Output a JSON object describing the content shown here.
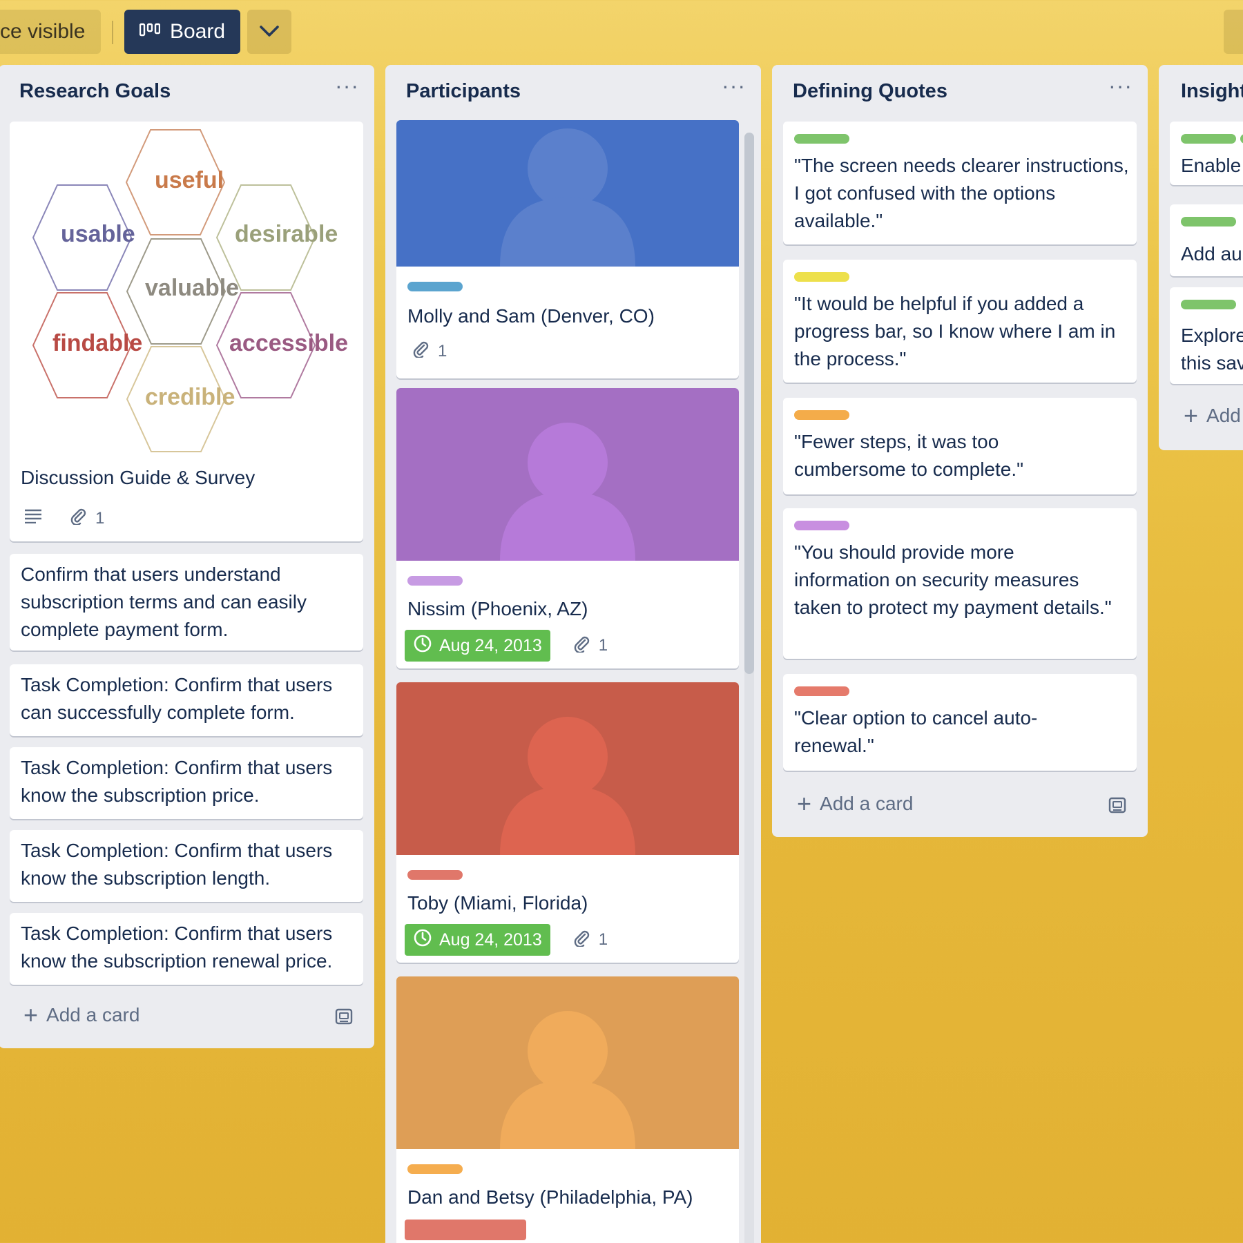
{
  "topbar": {
    "visibility_label": "ce visible",
    "board_label": "Board"
  },
  "colors": {
    "green": "#61bd4f",
    "blue_label": "#5ba4cf",
    "purple_label": "#c377e0",
    "red_label": "#eb5a46",
    "orange_label": "#ffab4a",
    "yellow_label": "#f2d600",
    "green_label": "#61bd4f"
  },
  "lists": {
    "research": {
      "title": "Research Goals",
      "menu": "···",
      "hex_words": [
        "useful",
        "usable",
        "desirable",
        "valuable",
        "findable",
        "accessible",
        "credible"
      ],
      "cards": [
        {
          "title": "Discussion Guide & Survey",
          "attachments": "1"
        },
        {
          "title": "Confirm that users understand subscription terms and can easily complete payment form."
        },
        {
          "title": "Task Completion: Confirm that users can successfully complete form."
        },
        {
          "title": "Task Completion: Confirm that users know the subscription price."
        },
        {
          "title": "Task Completion: Confirm that users know the subscription length."
        },
        {
          "title": "Task Completion: Confirm that users know the subscription renewal price."
        }
      ],
      "add_card": "Add a card"
    },
    "participants": {
      "title": "Participants",
      "menu": "···",
      "cards": [
        {
          "title": "Molly and Sam (Denver, CO)",
          "attachments": "1",
          "cover": "#4671c6",
          "avatar": "#5b80cc",
          "label": "#5ba4cf"
        },
        {
          "title": "Nissim (Phoenix, AZ)",
          "date": "Aug 24, 2013",
          "attachments": "1",
          "cover": "#a46fc3",
          "avatar": "#b67ad9",
          "label": "#c79be3"
        },
        {
          "title": "Toby (Miami, Florida)",
          "date": "Aug 24, 2013",
          "attachments": "1",
          "cover": "#c75c4a",
          "avatar": "#dd6450",
          "label": "#e0776a"
        },
        {
          "title": "Dan and Betsy (Philadelphia, PA)",
          "cover": "#de9e56",
          "avatar": "#f0ab5b",
          "label": "#f5ad4f"
        }
      ],
      "add_card": "Add a card"
    },
    "quotes": {
      "title": "Defining Quotes",
      "menu": "···",
      "cards": [
        {
          "title": "\"The screen needs clearer instructions, I got confused with the options available.\"",
          "label": "#7ec46b"
        },
        {
          "title": "\"It would be helpful if you added a progress bar, so I know where I am in the process.\"",
          "label": "#ede04b"
        },
        {
          "title": "\"Fewer steps, it was too cumbersome to complete.\"",
          "label": "#f4ac4a"
        },
        {
          "title": "\"You should provide more information on security measures taken to protect my payment details.\"",
          "label": "#c88fe0"
        },
        {
          "title": "\"Clear option to cancel auto-renewal.\"",
          "label": "#e57a6b"
        }
      ],
      "add_card": "Add a card"
    },
    "insights": {
      "title": "Insight",
      "cards": [
        {
          "title": "Enable",
          "label": "#7ec46b"
        },
        {
          "title": "Add au",
          "label": "#7ec46b"
        },
        {
          "title": "Explore this sav",
          "line1": "Explore",
          "line2": "this sav",
          "label": "#7ec46b"
        }
      ],
      "add_card": "Add"
    }
  }
}
